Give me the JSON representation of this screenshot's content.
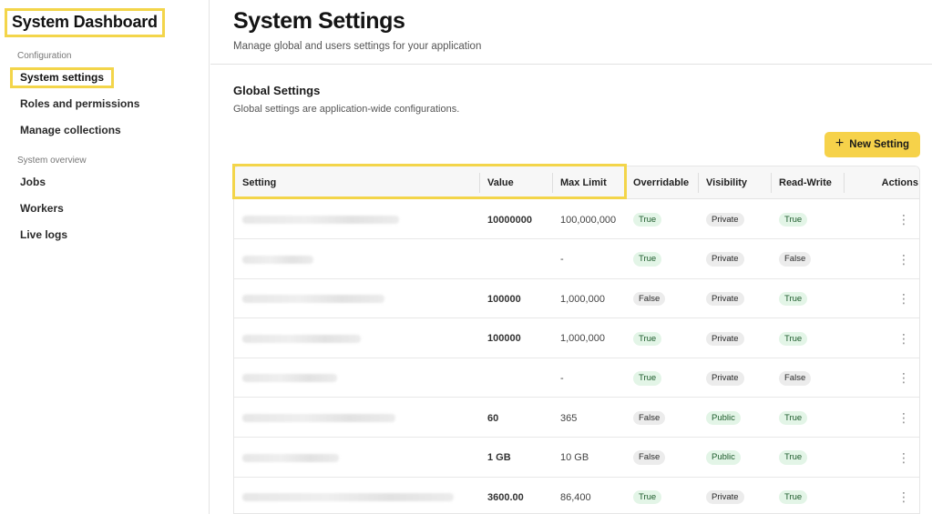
{
  "sidebar": {
    "app_title": "System Dashboard",
    "sections": [
      {
        "label": "Configuration",
        "items": [
          "System settings",
          "Roles and permissions",
          "Manage collections"
        ]
      },
      {
        "label": "System overview",
        "items": [
          "Jobs",
          "Workers",
          "Live logs"
        ]
      }
    ],
    "active_item": "System settings"
  },
  "header": {
    "title": "System Settings",
    "subtitle": "Manage global and users settings for your application"
  },
  "global_settings": {
    "title": "Global Settings",
    "description": "Global settings are application-wide configurations.",
    "new_button_label": "New Setting",
    "columns": [
      "Setting",
      "Value",
      "Max Limit",
      "Overridable",
      "Visibility",
      "Read-Write",
      "Actions"
    ],
    "rows": [
      {
        "value": "10000000",
        "max_limit": "100,000,000",
        "overridable": "True",
        "visibility": "Private",
        "read_write": "True"
      },
      {
        "value": "",
        "max_limit": "-",
        "overridable": "True",
        "visibility": "Private",
        "read_write": "False"
      },
      {
        "value": "100000",
        "max_limit": "1,000,000",
        "overridable": "False",
        "visibility": "Private",
        "read_write": "True"
      },
      {
        "value": "100000",
        "max_limit": "1,000,000",
        "overridable": "True",
        "visibility": "Private",
        "read_write": "True"
      },
      {
        "value": "",
        "max_limit": "-",
        "overridable": "True",
        "visibility": "Private",
        "read_write": "False"
      },
      {
        "value": "60",
        "max_limit": "365",
        "overridable": "False",
        "visibility": "Public",
        "read_write": "True"
      },
      {
        "value": "1 GB",
        "max_limit": "10 GB",
        "overridable": "False",
        "visibility": "Public",
        "read_write": "True"
      },
      {
        "value": "3600.00",
        "max_limit": "86,400",
        "overridable": "True",
        "visibility": "Private",
        "read_write": "True"
      }
    ]
  },
  "colors": {
    "highlight": "#f3d54a",
    "button": "#f6d24a",
    "badge_green_bg": "#e3f5e7",
    "badge_gray_bg": "#ececec"
  },
  "icons": {
    "new_button": "plus-icon",
    "row_actions": "kebab-menu-icon"
  }
}
